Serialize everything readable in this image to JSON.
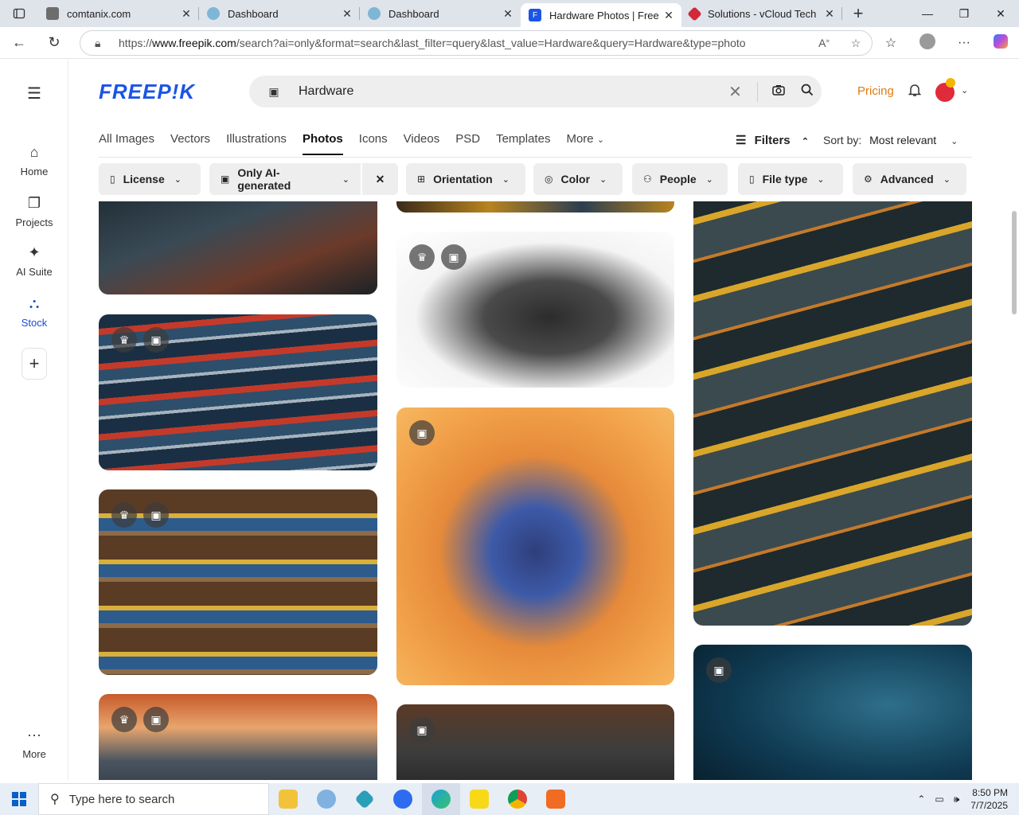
{
  "browser": {
    "tabs": [
      {
        "title": "comtanix.com",
        "fav_color": "#6d6d6d",
        "active": false
      },
      {
        "title": "Dashboard",
        "fav_color": "#7eb6d6",
        "active": false
      },
      {
        "title": "Dashboard",
        "fav_color": "#7eb6d6",
        "active": false
      },
      {
        "title": "Hardware Photos | Free do",
        "fav_color": "#1b54e6",
        "active": true
      },
      {
        "title": "Solutions - vCloud Tech",
        "fav_color": "#d1283a",
        "active": false
      }
    ],
    "url_prefix": "https://",
    "url_host": "www.freepik.com",
    "url_path": "/search?ai=only&format=search&last_filter=query&last_value=Hardware&query=Hardware&type=photo"
  },
  "site": {
    "logo": "FREEP!K",
    "search_query": "Hardware",
    "pricing_label": "Pricing",
    "accent": "#1b54e6",
    "pricing_color": "#e07b10"
  },
  "rail": {
    "items": [
      {
        "label": "Home",
        "icon": "home-icon",
        "glyph": "⌂"
      },
      {
        "label": "Projects",
        "icon": "projects-icon",
        "glyph": "❐"
      },
      {
        "label": "AI Suite",
        "icon": "sparkle-icon",
        "glyph": "✦"
      },
      {
        "label": "Stock",
        "icon": "stock-icon",
        "glyph": "⛬"
      }
    ],
    "more_label": "More"
  },
  "categories": [
    "All Images",
    "Vectors",
    "Illustrations",
    "Photos",
    "Icons",
    "Videos",
    "PSD",
    "Templates",
    "More"
  ],
  "active_category": "Photos",
  "filters_label": "Filters",
  "sort": {
    "label": "Sort by:",
    "value": "Most relevant"
  },
  "chips": [
    "License",
    "Only AI-generated",
    "Orientation",
    "Color",
    "People",
    "File type",
    "Advanced"
  ],
  "taskbar": {
    "search_placeholder": "Type here to search",
    "time": "8:50 PM",
    "date": "7/7/2025"
  }
}
